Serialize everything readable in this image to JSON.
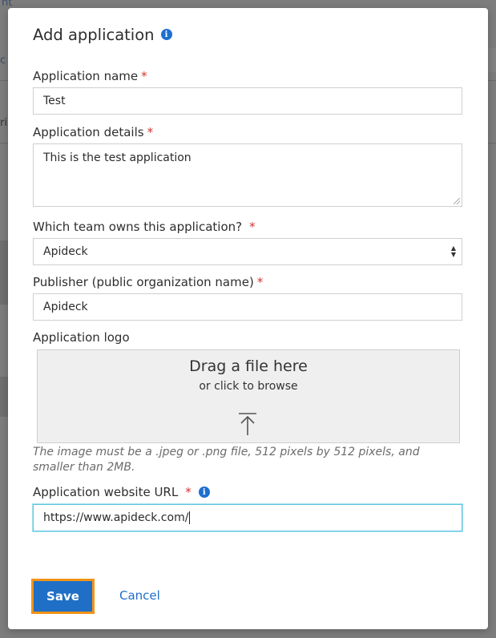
{
  "background": {
    "tab_fragment": "nt",
    "left_fragment_1": "c",
    "left_fragment_2": "ri"
  },
  "modal": {
    "title": "Add application",
    "info_icon": "info-icon",
    "fields": {
      "app_name": {
        "label": "Application name",
        "required_mark": "*",
        "value": "Test"
      },
      "app_details": {
        "label": "Application details",
        "required_mark": "*",
        "value": "This is the test application"
      },
      "team": {
        "label": "Which team owns this application?",
        "required_mark": "*",
        "selected": "Apideck"
      },
      "publisher": {
        "label": "Publisher (public organization name)",
        "required_mark": "*",
        "value": "Apideck"
      },
      "logo": {
        "label": "Application logo",
        "drop_title": "Drag a file here",
        "drop_subtitle": "or click to browse",
        "helper": "The image must be a .jpeg or .png file, 512 pixels by 512 pixels, and smaller than 2MB."
      },
      "website": {
        "label": "Application website URL",
        "required_mark": "*",
        "value": "https://www.apideck.com/"
      }
    },
    "actions": {
      "save_label": "Save",
      "cancel_label": "Cancel"
    }
  },
  "colors": {
    "accent": "#1f6fc7",
    "focus_outline": "#f39317",
    "required": "#d0342c",
    "input_focus": "#5fc6df"
  }
}
